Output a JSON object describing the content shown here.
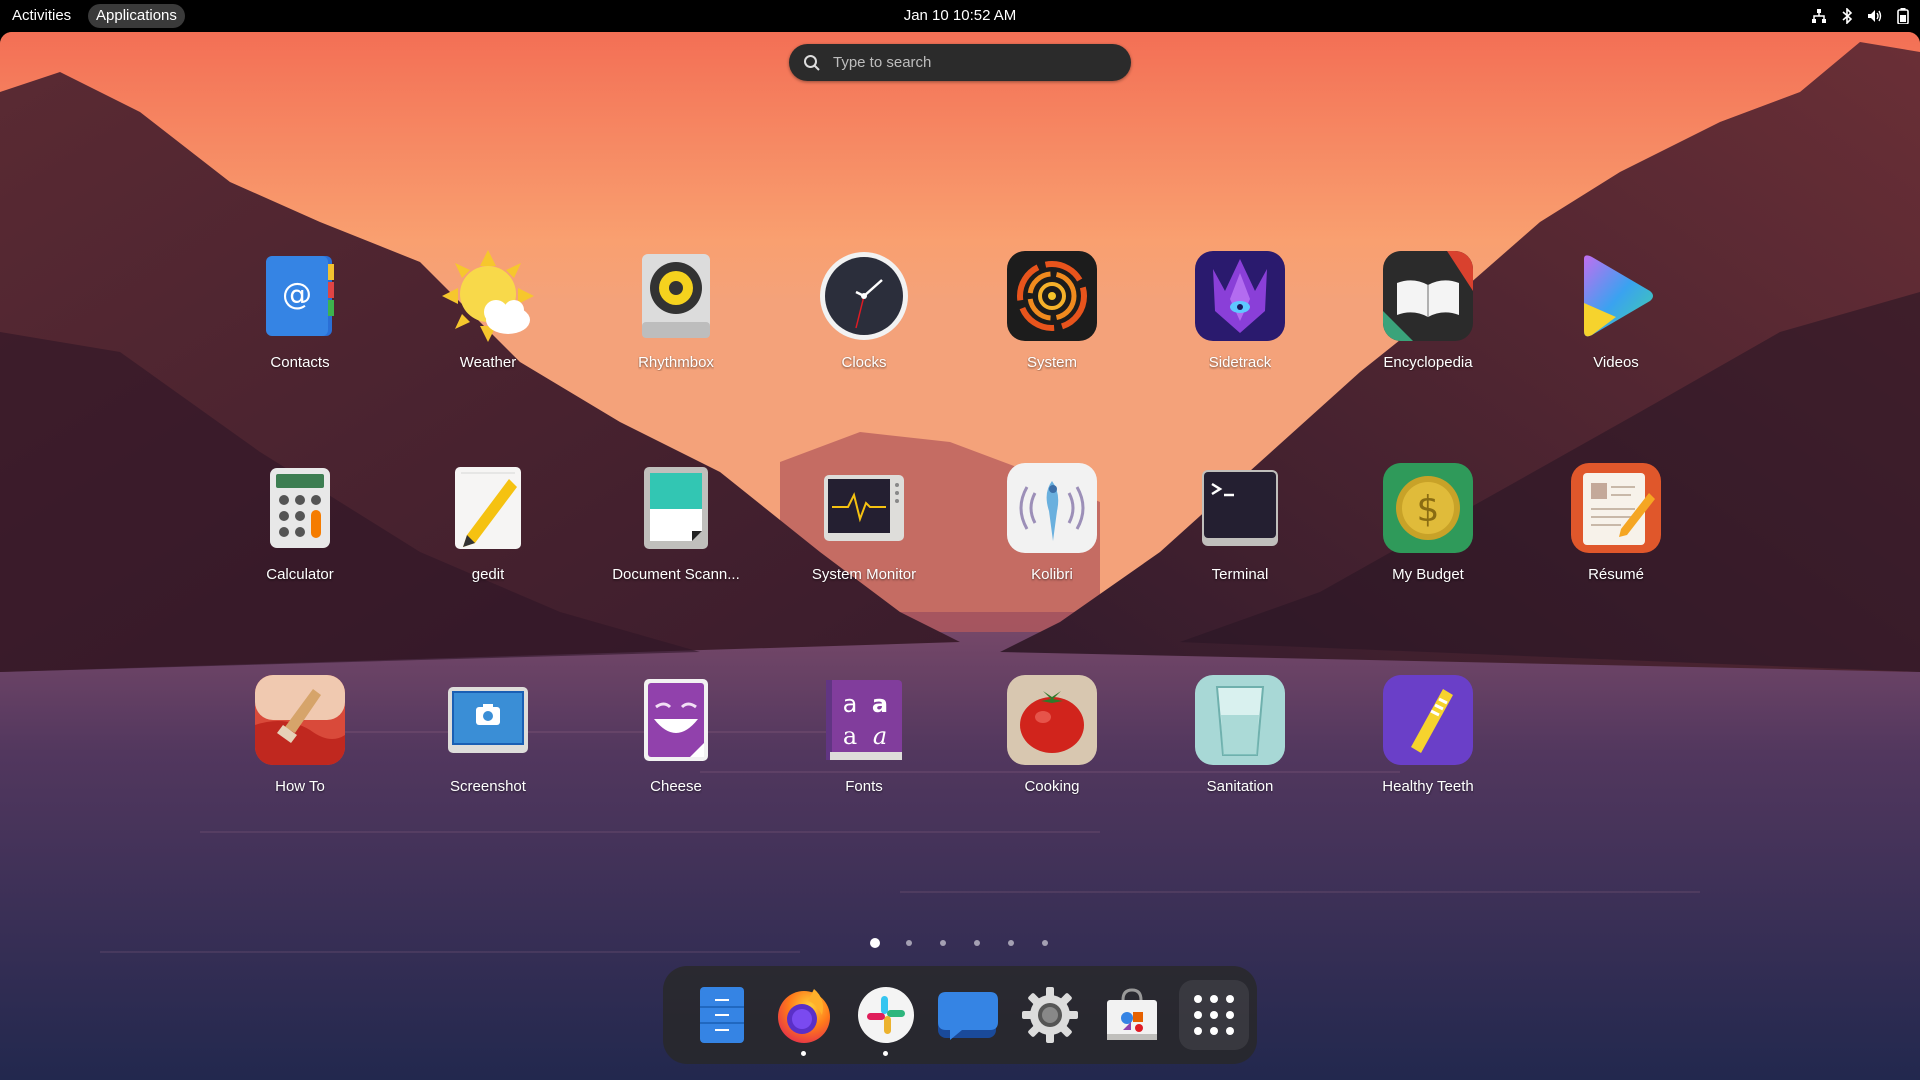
{
  "topbar": {
    "activities": "Activities",
    "applications": "Applications",
    "datetime": "Jan 10  10:52 AM",
    "tray_icons": [
      "network-icon",
      "bluetooth-icon",
      "volume-icon",
      "battery-icon"
    ]
  },
  "search": {
    "placeholder": "Type to search"
  },
  "apps": [
    {
      "label": "Contacts"
    },
    {
      "label": "Weather"
    },
    {
      "label": "Rhythmbox"
    },
    {
      "label": "Clocks"
    },
    {
      "label": "System"
    },
    {
      "label": "Sidetrack"
    },
    {
      "label": "Encyclopedia"
    },
    {
      "label": "Videos"
    },
    {
      "label": "Calculator"
    },
    {
      "label": "gedit"
    },
    {
      "label": "Document Scann..."
    },
    {
      "label": "System Monitor"
    },
    {
      "label": "Kolibri"
    },
    {
      "label": "Terminal"
    },
    {
      "label": "My Budget"
    },
    {
      "label": "Résumé"
    },
    {
      "label": "How To"
    },
    {
      "label": "Screenshot"
    },
    {
      "label": "Cheese"
    },
    {
      "label": "Fonts"
    },
    {
      "label": "Cooking"
    },
    {
      "label": "Sanitation"
    },
    {
      "label": "Healthy Teeth"
    }
  ],
  "pages": {
    "count": 6,
    "current": 1
  },
  "dock": {
    "items": [
      {
        "icon": "files-icon",
        "running": false
      },
      {
        "icon": "firefox-icon",
        "running": true
      },
      {
        "icon": "slack-icon",
        "running": true
      },
      {
        "icon": "chat-icon",
        "running": false
      },
      {
        "icon": "settings-gear-icon",
        "running": false
      },
      {
        "icon": "software-store-icon",
        "running": false
      },
      {
        "icon": "app-grid-icon",
        "running": false
      }
    ]
  },
  "colors": {
    "topbar": "#000000",
    "dock": "#282828",
    "search": "#2b2b2b"
  }
}
